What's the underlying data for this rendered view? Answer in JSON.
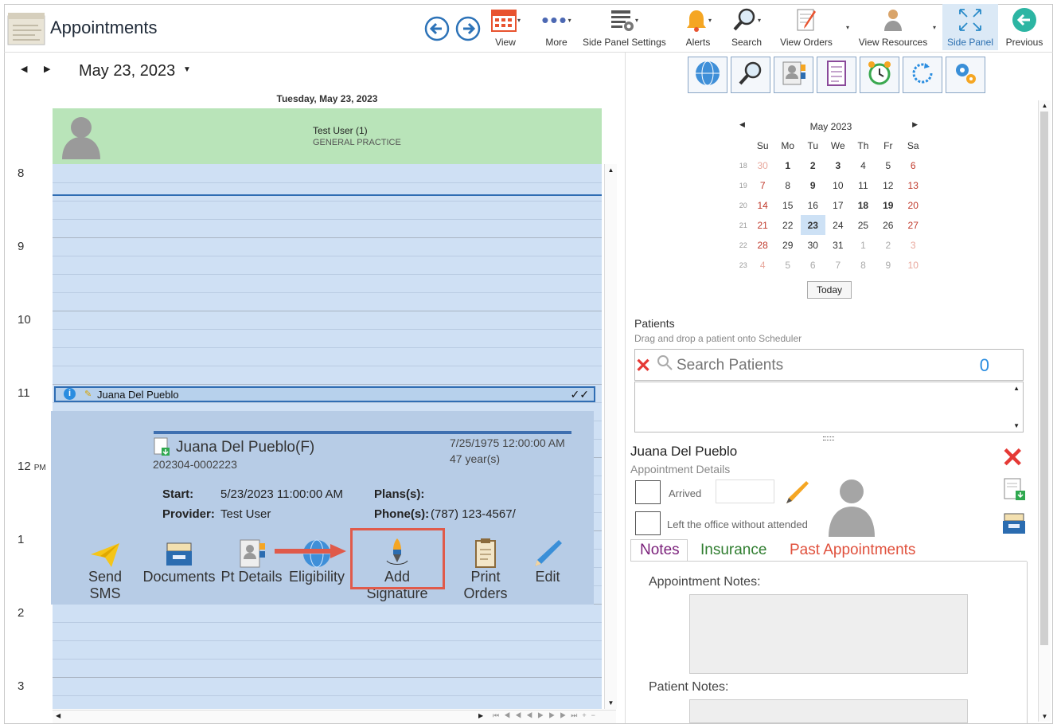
{
  "window": {
    "title": "Appointments"
  },
  "toolbar": {
    "view": "View",
    "more": "More",
    "side_panel_settings": "Side Panel Settings",
    "alerts": "Alerts",
    "search": "Search",
    "view_orders": "View Orders",
    "view_resources": "View Resources",
    "side_panel": "Side Panel",
    "previous": "Previous"
  },
  "scheduler": {
    "date": "May 23, 2023",
    "day_header": "Tuesday, May 23, 2023",
    "resource_name": "Test User (1)",
    "resource_sub": "GENERAL PRACTICE",
    "hours": [
      "8",
      "9",
      "10",
      "11",
      "12",
      "1",
      "2",
      "3"
    ],
    "pm_label": "PM",
    "appointment": {
      "name": "Juana Del Pueblo",
      "checks": "✓✓"
    }
  },
  "popup": {
    "patient": "Juana Del Pueblo(F)",
    "id": "202304-0002223",
    "dob": "7/25/1975 12:00:00 AM",
    "age": "47 year(s)",
    "start_label": "Start:",
    "start_value": "5/23/2023 11:00:00 AM",
    "provider_label": "Provider:",
    "provider_value": "Test User",
    "plans_label": "Plans(s):",
    "phone_label": "Phone(s):",
    "phone_value": "(787) 123-4567/",
    "actions": [
      "Send SMS",
      "Documents",
      "Pt Details",
      "Eligibility",
      "Add Signature",
      "Print Orders",
      "Edit"
    ]
  },
  "calendar": {
    "month": "May 2023",
    "days": [
      "Su",
      "Mo",
      "Tu",
      "We",
      "Th",
      "Fr",
      "Sa"
    ],
    "weeks": [
      [
        "18",
        "30",
        "1",
        "2",
        "3",
        "4",
        "5",
        "6"
      ],
      [
        "19",
        "7",
        "8",
        "9",
        "10",
        "11",
        "12",
        "13"
      ],
      [
        "20",
        "14",
        "15",
        "16",
        "17",
        "18",
        "19",
        "20"
      ],
      [
        "21",
        "21",
        "22",
        "23",
        "24",
        "25",
        "26",
        "27"
      ],
      [
        "22",
        "28",
        "29",
        "30",
        "31",
        "1",
        "2",
        "3"
      ],
      [
        "23",
        "4",
        "5",
        "6",
        "7",
        "8",
        "9",
        "10"
      ]
    ],
    "today": "Today"
  },
  "patients": {
    "title": "Patients",
    "hint": "Drag and drop a patient onto Scheduler",
    "placeholder": "Search Patients",
    "count": "0"
  },
  "details": {
    "name": "Juana Del Pueblo",
    "sub": "Appointment Details",
    "arrived": "Arrived",
    "left_office": "Left the office without attended",
    "tabs": [
      "Notes",
      "Insurance",
      "Past Appointments"
    ],
    "appointment_notes": "Appointment Notes:",
    "patient_notes": "Patient Notes:"
  },
  "colors": {
    "accent": "#2f6db3",
    "highlight": "#e05a4a",
    "tab_notes": "#7a1f7a",
    "tab_ins": "#2f7d2f",
    "tab_past": "#e0503c"
  }
}
